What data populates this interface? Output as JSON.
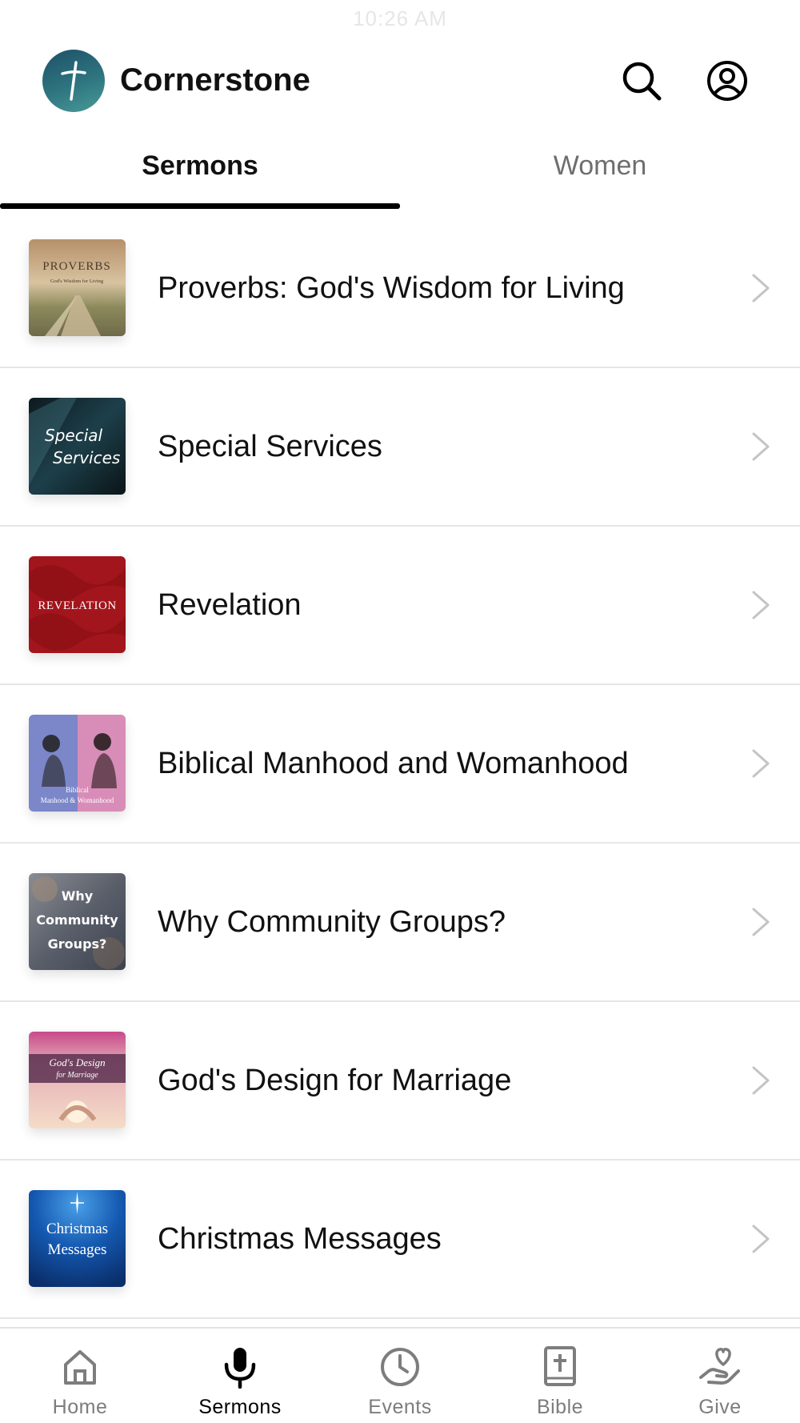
{
  "status_bar": {
    "time": "10:26 AM"
  },
  "header": {
    "title": "Cornerstone"
  },
  "tabs": [
    {
      "label": "Sermons",
      "active": true
    },
    {
      "label": "Women",
      "active": false
    }
  ],
  "series": [
    {
      "title": "Proverbs: God's Wisdom for Living",
      "thumb_text": "PROVERBS",
      "thumb_subtext": "God's Wisdom for Living"
    },
    {
      "title": "Special Services",
      "thumb_text": "Special",
      "thumb_subtext": "Services"
    },
    {
      "title": "Revelation",
      "thumb_text": "REVELATION"
    },
    {
      "title": "Biblical Manhood and Womanhood",
      "thumb_text": "Biblical",
      "thumb_subtext": "Manhood & Womanhood"
    },
    {
      "title": "Why Community Groups?",
      "thumb_text": "Why",
      "thumb_subtext": "Community",
      "thumb_subtext2": "Groups?"
    },
    {
      "title": "God's Design for Marriage",
      "thumb_text": "God's Design",
      "thumb_subtext": "for Marriage"
    },
    {
      "title": "Christmas Messages",
      "thumb_text": "Christmas",
      "thumb_subtext": "Messages"
    }
  ],
  "tab_bar": [
    {
      "label": "Home",
      "icon": "home-icon"
    },
    {
      "label": "Sermons",
      "icon": "microphone-icon",
      "active": true
    },
    {
      "label": "Events",
      "icon": "clock-icon"
    },
    {
      "label": "Bible",
      "icon": "bible-icon"
    },
    {
      "label": "Give",
      "icon": "give-heart-hand-icon"
    }
  ],
  "colors": {
    "active": "#000000",
    "inactive": "#7d7d7d",
    "divider": "#e6e6e6",
    "logo": "#2e7580"
  }
}
